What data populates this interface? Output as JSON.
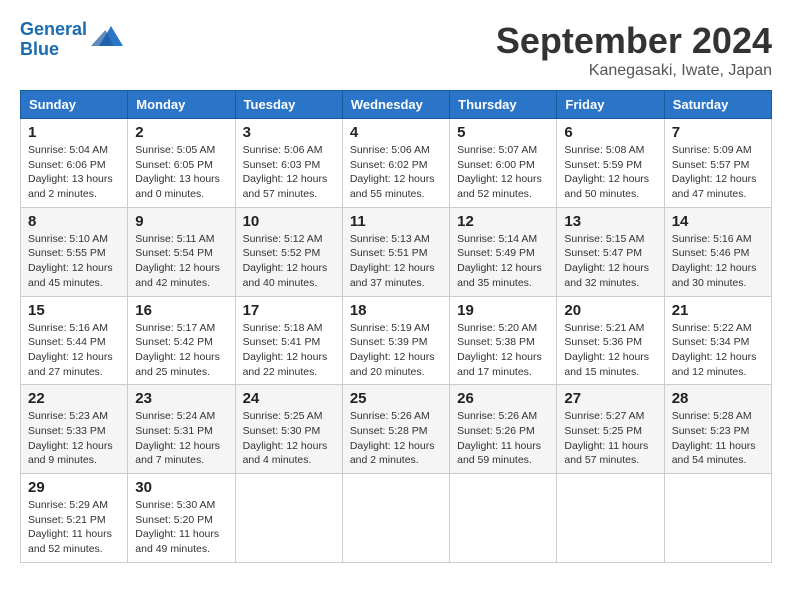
{
  "header": {
    "logo_line1": "General",
    "logo_line2": "Blue",
    "month": "September 2024",
    "location": "Kanegasaki, Iwate, Japan"
  },
  "weekdays": [
    "Sunday",
    "Monday",
    "Tuesday",
    "Wednesday",
    "Thursday",
    "Friday",
    "Saturday"
  ],
  "weeks": [
    [
      {
        "day": "1",
        "info": "Sunrise: 5:04 AM\nSunset: 6:06 PM\nDaylight: 13 hours\nand 2 minutes."
      },
      {
        "day": "2",
        "info": "Sunrise: 5:05 AM\nSunset: 6:05 PM\nDaylight: 13 hours\nand 0 minutes."
      },
      {
        "day": "3",
        "info": "Sunrise: 5:06 AM\nSunset: 6:03 PM\nDaylight: 12 hours\nand 57 minutes."
      },
      {
        "day": "4",
        "info": "Sunrise: 5:06 AM\nSunset: 6:02 PM\nDaylight: 12 hours\nand 55 minutes."
      },
      {
        "day": "5",
        "info": "Sunrise: 5:07 AM\nSunset: 6:00 PM\nDaylight: 12 hours\nand 52 minutes."
      },
      {
        "day": "6",
        "info": "Sunrise: 5:08 AM\nSunset: 5:59 PM\nDaylight: 12 hours\nand 50 minutes."
      },
      {
        "day": "7",
        "info": "Sunrise: 5:09 AM\nSunset: 5:57 PM\nDaylight: 12 hours\nand 47 minutes."
      }
    ],
    [
      {
        "day": "8",
        "info": "Sunrise: 5:10 AM\nSunset: 5:55 PM\nDaylight: 12 hours\nand 45 minutes."
      },
      {
        "day": "9",
        "info": "Sunrise: 5:11 AM\nSunset: 5:54 PM\nDaylight: 12 hours\nand 42 minutes."
      },
      {
        "day": "10",
        "info": "Sunrise: 5:12 AM\nSunset: 5:52 PM\nDaylight: 12 hours\nand 40 minutes."
      },
      {
        "day": "11",
        "info": "Sunrise: 5:13 AM\nSunset: 5:51 PM\nDaylight: 12 hours\nand 37 minutes."
      },
      {
        "day": "12",
        "info": "Sunrise: 5:14 AM\nSunset: 5:49 PM\nDaylight: 12 hours\nand 35 minutes."
      },
      {
        "day": "13",
        "info": "Sunrise: 5:15 AM\nSunset: 5:47 PM\nDaylight: 12 hours\nand 32 minutes."
      },
      {
        "day": "14",
        "info": "Sunrise: 5:16 AM\nSunset: 5:46 PM\nDaylight: 12 hours\nand 30 minutes."
      }
    ],
    [
      {
        "day": "15",
        "info": "Sunrise: 5:16 AM\nSunset: 5:44 PM\nDaylight: 12 hours\nand 27 minutes."
      },
      {
        "day": "16",
        "info": "Sunrise: 5:17 AM\nSunset: 5:42 PM\nDaylight: 12 hours\nand 25 minutes."
      },
      {
        "day": "17",
        "info": "Sunrise: 5:18 AM\nSunset: 5:41 PM\nDaylight: 12 hours\nand 22 minutes."
      },
      {
        "day": "18",
        "info": "Sunrise: 5:19 AM\nSunset: 5:39 PM\nDaylight: 12 hours\nand 20 minutes."
      },
      {
        "day": "19",
        "info": "Sunrise: 5:20 AM\nSunset: 5:38 PM\nDaylight: 12 hours\nand 17 minutes."
      },
      {
        "day": "20",
        "info": "Sunrise: 5:21 AM\nSunset: 5:36 PM\nDaylight: 12 hours\nand 15 minutes."
      },
      {
        "day": "21",
        "info": "Sunrise: 5:22 AM\nSunset: 5:34 PM\nDaylight: 12 hours\nand 12 minutes."
      }
    ],
    [
      {
        "day": "22",
        "info": "Sunrise: 5:23 AM\nSunset: 5:33 PM\nDaylight: 12 hours\nand 9 minutes."
      },
      {
        "day": "23",
        "info": "Sunrise: 5:24 AM\nSunset: 5:31 PM\nDaylight: 12 hours\nand 7 minutes."
      },
      {
        "day": "24",
        "info": "Sunrise: 5:25 AM\nSunset: 5:30 PM\nDaylight: 12 hours\nand 4 minutes."
      },
      {
        "day": "25",
        "info": "Sunrise: 5:26 AM\nSunset: 5:28 PM\nDaylight: 12 hours\nand 2 minutes."
      },
      {
        "day": "26",
        "info": "Sunrise: 5:26 AM\nSunset: 5:26 PM\nDaylight: 11 hours\nand 59 minutes."
      },
      {
        "day": "27",
        "info": "Sunrise: 5:27 AM\nSunset: 5:25 PM\nDaylight: 11 hours\nand 57 minutes."
      },
      {
        "day": "28",
        "info": "Sunrise: 5:28 AM\nSunset: 5:23 PM\nDaylight: 11 hours\nand 54 minutes."
      }
    ],
    [
      {
        "day": "29",
        "info": "Sunrise: 5:29 AM\nSunset: 5:21 PM\nDaylight: 11 hours\nand 52 minutes."
      },
      {
        "day": "30",
        "info": "Sunrise: 5:30 AM\nSunset: 5:20 PM\nDaylight: 11 hours\nand 49 minutes."
      },
      {
        "day": "",
        "info": ""
      },
      {
        "day": "",
        "info": ""
      },
      {
        "day": "",
        "info": ""
      },
      {
        "day": "",
        "info": ""
      },
      {
        "day": "",
        "info": ""
      }
    ]
  ]
}
